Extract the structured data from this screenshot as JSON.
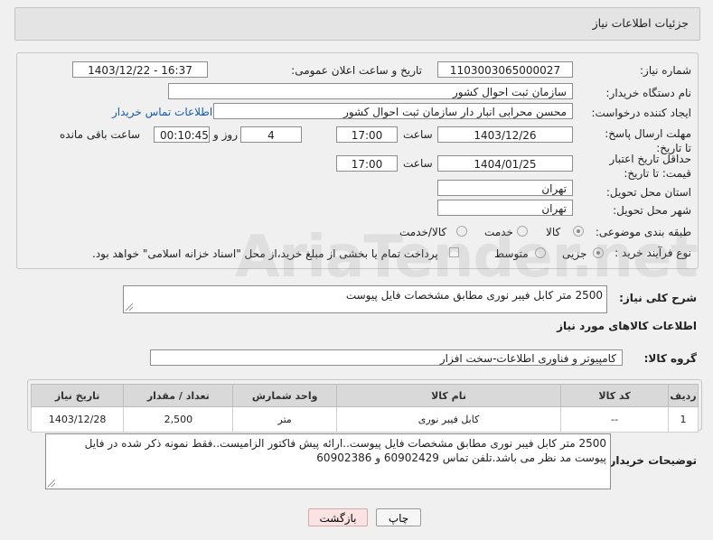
{
  "header": {
    "title": "جزئیات اطلاعات نیاز"
  },
  "form": {
    "need_number": {
      "label": "شماره نیاز:",
      "value": "1103003065000027"
    },
    "announce_datetime": {
      "label": "تاریخ و ساعت اعلان عمومی:",
      "value": "1403/12/22 - 16:37"
    },
    "buyer_org": {
      "label": "نام دستگاه خریدار:",
      "value": "سازمان ثبت احوال کشور"
    },
    "requester": {
      "label": "ایجاد کننده درخواست:",
      "value": "محسن محرابی انبار دار سازمان ثبت احوال کشور"
    },
    "contact_link": "اطلاعات تماس خریدار",
    "reply_deadline": {
      "label": "مهلت ارسال پاسخ: تا تاریخ:",
      "date": "1403/12/26",
      "time_label": "ساعت",
      "time": "17:00",
      "days": "4",
      "days_label": "روز و",
      "remaining": "00:10:45",
      "remaining_label": "ساعت باقی مانده"
    },
    "price_validity": {
      "label": "حداقل تاریخ اعتبار قیمت: تا تاریخ:",
      "date": "1404/01/25",
      "time_label": "ساعت",
      "time": "17:00"
    },
    "province": {
      "label": "استان محل تحویل:",
      "value": "تهران"
    },
    "city": {
      "label": "شهر محل تحویل:",
      "value": "تهران"
    },
    "category": {
      "label": "طبقه بندی موضوعی:",
      "options": [
        "کالا",
        "خدمت",
        "کالا/خدمت"
      ],
      "selected": "کالا"
    },
    "process_type": {
      "label": "نوع فرآیند خرید :",
      "options": [
        "جزیی",
        "متوسط"
      ],
      "checkbox_text": "پرداخت تمام یا بخشی از مبلغ خرید،از محل \"اسناد خزانه اسلامی\" خواهد بود."
    }
  },
  "description": {
    "label": "شرح کلی نیاز:",
    "value": "2500 متر کابل فیبر نوری مطابق مشخصات فایل پیوست"
  },
  "goods": {
    "section_title": "اطلاعات کالاهای مورد نیاز",
    "group_label": "گروه کالا:",
    "group_value": "کامپیوتر و فناوری اطلاعات-سخت افزار",
    "columns": [
      "ردیف",
      "کد کالا",
      "نام کالا",
      "واحد شمارش",
      "تعداد / مقدار",
      "تاریخ نیاز"
    ],
    "rows": [
      [
        "1",
        "--",
        "کابل فیبر نوری",
        "متر",
        "2,500",
        "1403/12/28"
      ]
    ]
  },
  "buyer_notes": {
    "label": "توضیحات خریدار:",
    "value": "2500 متر کابل فیبر نوری مطابق مشخصات فایل پیوست..ارائه پیش فاکتور الزامیست..فقط نمونه ذکر شده در فایل پیوست مد نظر می باشد.تلفن تماس 60902429 و 60902386"
  },
  "buttons": {
    "print": "چاپ",
    "back": "بازگشت"
  },
  "watermark": "AriaTender.net"
}
